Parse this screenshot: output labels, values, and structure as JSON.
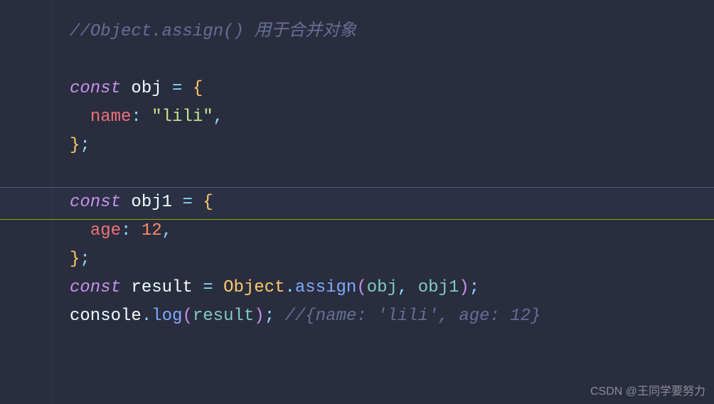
{
  "code": {
    "line1": {
      "comment": "//Object.assign() 用于合并对象"
    },
    "line3": {
      "keyword": "const",
      "ident": "obj",
      "eq": "=",
      "brace": "{"
    },
    "line4": {
      "prop": "name",
      "colon": ":",
      "str": "\"lili\"",
      "comma": ","
    },
    "line5": {
      "brace": "}",
      "semi": ";"
    },
    "line7": {
      "keyword": "const",
      "ident": "obj1",
      "eq": "=",
      "brace": "{"
    },
    "line8": {
      "prop": "age",
      "colon": ":",
      "num": "12",
      "comma": ","
    },
    "line9": {
      "brace": "}",
      "semi": ";"
    },
    "line10": {
      "keyword": "const",
      "ident": "result",
      "eq": "=",
      "class": "Object",
      "dot": ".",
      "method": "assign",
      "lp": "(",
      "arg1": "obj",
      "comma": ",",
      "arg2": "obj1",
      "rp": ")",
      "semi": ";"
    },
    "line11": {
      "ident": "console",
      "dot": ".",
      "method": "log",
      "lp": "(",
      "arg": "result",
      "rp": ")",
      "semi": ";",
      "comment": "//{name: 'lili', age: 12}"
    }
  },
  "watermark": "CSDN @王同学要努力"
}
